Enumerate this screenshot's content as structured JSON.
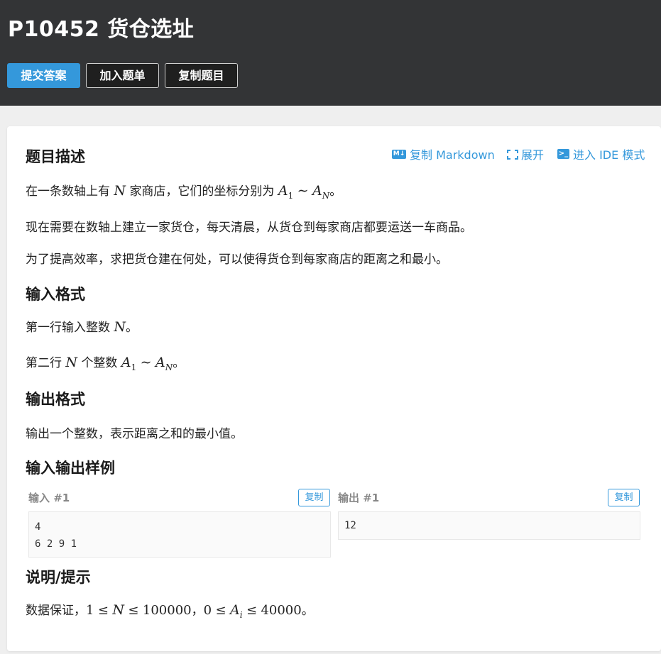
{
  "header": {
    "title": "P10452 货仓选址",
    "buttons": {
      "submit": "提交答案",
      "add_list": "加入题单",
      "copy_problem": "复制题目"
    }
  },
  "toolbar": {
    "copy_md": "复制 Markdown",
    "expand": "展开",
    "ide": "进入 IDE 模式"
  },
  "sections": {
    "desc_title": "题目描述",
    "desc_p1_a": "在一条数轴上有",
    "desc_p1_b": "家商店，它们的坐标分别为",
    "desc_p2": "现在需要在数轴上建立一家货仓，每天清晨，从货仓到每家商店都要运送一车商品。",
    "desc_p3": "为了提高效率，求把货仓建在何处，可以使得货仓到每家商店的距离之和最小。",
    "input_title": "输入格式",
    "input_p1_a": "第一行输入整数",
    "input_p2_a": "第二行",
    "input_p2_b": "个整数",
    "output_title": "输出格式",
    "output_p1": "输出一个整数，表示距离之和的最小值。",
    "sample_title": "输入输出样例",
    "hint_title": "说明/提示",
    "hint_a": "数据保证，",
    "hint_n1": "1",
    "hint_n2": "100000",
    "hint_n3": "0",
    "hint_n4": "40000"
  },
  "math": {
    "N": "N",
    "A": "A",
    "sub1": "1",
    "subN": "N",
    "subi": "i",
    "tilde": "∼",
    "le": "≤",
    "period": "。",
    "comma": "，"
  },
  "samples": {
    "input_label": "输入 #1",
    "output_label": "输出 #1",
    "copy": "复制",
    "input_line1": "4",
    "input_line2": "6 2 9 1",
    "output_line1": "12"
  }
}
